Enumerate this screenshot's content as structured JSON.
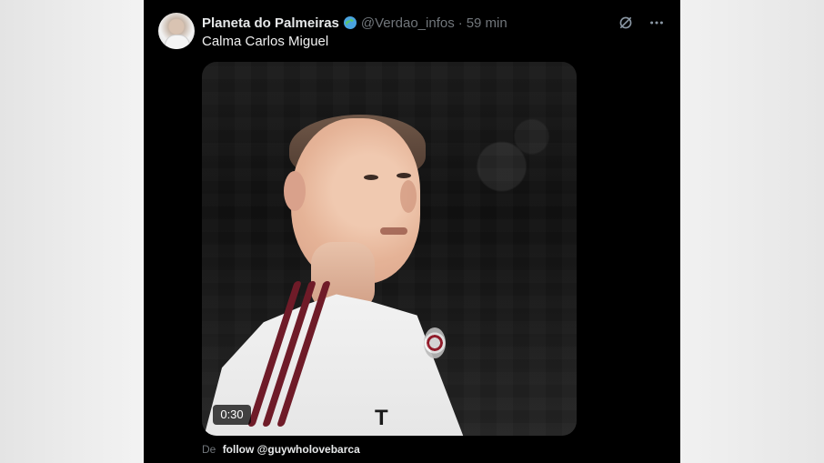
{
  "tweet": {
    "author_name": "Planeta do Palmeiras",
    "handle": "@Verdao_infos",
    "separator": "·",
    "time_ago": "59 min",
    "text": "Calma Carlos Miguel",
    "source_prefix": "De",
    "source_link": "follow @guywholovebarca"
  },
  "media": {
    "duration": "0:30"
  },
  "icons": {
    "globe": "globe-icon",
    "grok": "grok-icon",
    "more": "more-icon"
  },
  "colors": {
    "background": "#000000",
    "text": "#e7e9ea",
    "muted": "#71767b"
  }
}
